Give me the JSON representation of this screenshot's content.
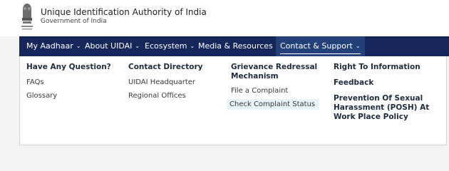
{
  "header": {
    "org_name": "Unique Identification Authority of India",
    "org_sub": "Government of India",
    "emblem_icon": "national-emblem-icon"
  },
  "nav": {
    "items": [
      {
        "label": "My Aadhaar",
        "icon": "chevron-down-icon"
      },
      {
        "label": "About UIDAI",
        "icon": "chevron-down-icon"
      },
      {
        "label": "Ecosystem",
        "icon": "chevron-down-icon"
      },
      {
        "label": "Media & Resources",
        "icon": "chevron-down-icon"
      },
      {
        "label": "Contact & Support",
        "icon": "chevron-down-icon",
        "active": true
      }
    ],
    "chevron": "⌄"
  },
  "dropdown": {
    "col1": {
      "heading": "Have Any Question?",
      "links": [
        "FAQs",
        "Glossary"
      ]
    },
    "col2": {
      "heading": "Contact Directory",
      "links": [
        "UIDAI Headquarter",
        "Regional Offices"
      ]
    },
    "col3": {
      "heading_line1": "Grievance Redressal",
      "heading_line2": "Mechanism",
      "links": [
        "File a Complaint",
        "Check Complaint Status"
      ]
    },
    "col4": {
      "items": [
        "Right To Information",
        "Feedback"
      ],
      "posh_line1": "Prevention Of Sexual",
      "posh_line2": "Harassment (POSH) At",
      "posh_line3": "Work Place Policy"
    }
  },
  "colors": {
    "navbar": "#14265a",
    "active_tab": "#24407a",
    "highlight": "#e7f3f7"
  }
}
